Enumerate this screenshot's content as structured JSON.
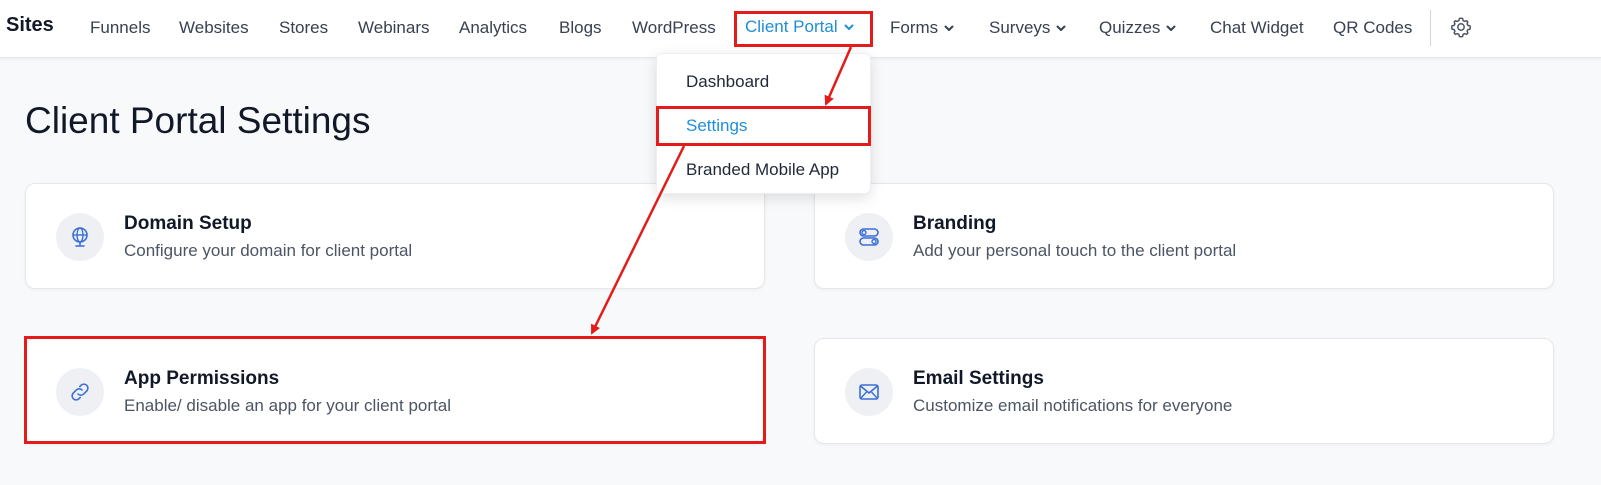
{
  "topbar": {
    "brand": "Sites",
    "nav": [
      {
        "label": "Funnels"
      },
      {
        "label": "Websites"
      },
      {
        "label": "Stores"
      },
      {
        "label": "Webinars"
      },
      {
        "label": "Analytics"
      },
      {
        "label": "Blogs"
      },
      {
        "label": "WordPress"
      },
      {
        "label": "Client Portal",
        "active": true,
        "has_dropdown": true
      },
      {
        "label": "Forms",
        "has_dropdown": true
      },
      {
        "label": "Surveys",
        "has_dropdown": true
      },
      {
        "label": "Quizzes",
        "has_dropdown": true
      },
      {
        "label": "Chat Widget"
      },
      {
        "label": "QR Codes"
      }
    ],
    "settings_icon": "gear-icon"
  },
  "dropdown": {
    "items": [
      {
        "label": "Dashboard"
      },
      {
        "label": "Settings",
        "active": true
      },
      {
        "label": "Branded Mobile App"
      }
    ]
  },
  "page": {
    "title": "Client Portal Settings"
  },
  "cards": [
    {
      "title": "Domain Setup",
      "desc": "Configure your domain for client portal",
      "icon": "globe-icon"
    },
    {
      "title": "Branding",
      "desc": "Add your personal touch to the client portal",
      "icon": "toggles-icon"
    },
    {
      "title": "App Permissions",
      "desc": "Enable/ disable an app for your client portal",
      "icon": "link-icon"
    },
    {
      "title": "Email Settings",
      "desc": "Customize email notifications for everyone",
      "icon": "envelope-icon"
    }
  ],
  "colors": {
    "accent": "#1e8fd6",
    "annotation": "#e41b1b",
    "icon_blue": "#3b6fd8"
  }
}
